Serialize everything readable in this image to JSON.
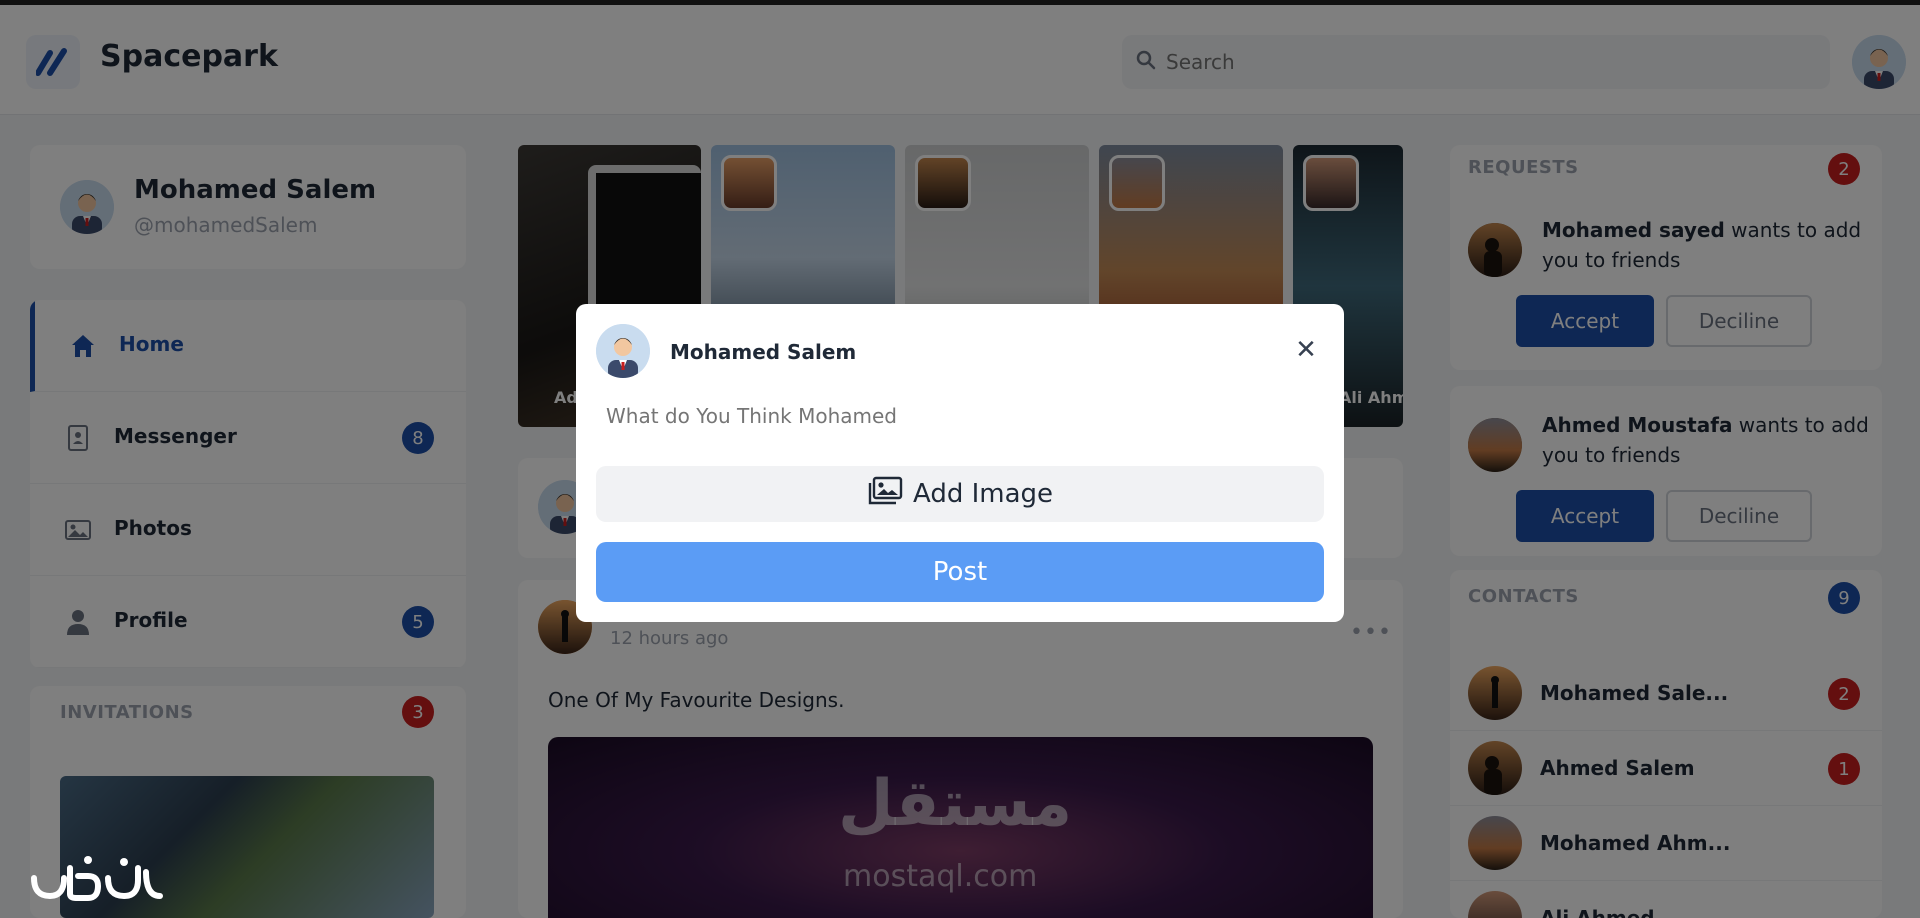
{
  "app": {
    "name": "Spacepark",
    "accent": "#1c4fa8"
  },
  "header": {
    "search_placeholder": "Search"
  },
  "profile": {
    "name": "Mohamed Salem",
    "handle": "@mohamedSalem"
  },
  "nav": {
    "items": [
      {
        "label": "Home",
        "icon": "home-icon",
        "active": true
      },
      {
        "label": "Messenger",
        "icon": "contact-book-icon",
        "badge": "8"
      },
      {
        "label": "Photos",
        "icon": "image-icon"
      },
      {
        "label": "Profile",
        "icon": "user-icon",
        "badge": "5"
      }
    ]
  },
  "invitations": {
    "title": "INVITATIONS",
    "count": "3"
  },
  "stories": [
    {
      "name": "Ad"
    },
    {
      "name": ""
    },
    {
      "name": ""
    },
    {
      "name": ""
    },
    {
      "name": "Ali Ahm"
    }
  ],
  "post": {
    "time": "12 hours ago",
    "text": "One Of My Favourite Designs.",
    "watermark_ar": "مستقل",
    "watermark_url": "mostaql.com"
  },
  "requests": {
    "title": "REQUESTS",
    "count": "2",
    "items": [
      {
        "name": "Mohamed sayed",
        "text": " wants to add you to friends",
        "accept": "Accept",
        "decline": "Deciline"
      },
      {
        "name": "Ahmed Moustafa",
        "text": " wants to add you to friends",
        "accept": "Accept",
        "decline": "Deciline"
      }
    ]
  },
  "contacts": {
    "title": "CONTACTS",
    "count": "9",
    "items": [
      {
        "name": "Mohamed Sale...",
        "badge": "2"
      },
      {
        "name": "Ahmed Salem",
        "badge": "1"
      },
      {
        "name": "Mohamed Ahm...",
        "badge": ""
      },
      {
        "name": "Ali Ahmed",
        "badge": ""
      }
    ]
  },
  "modal": {
    "user": "Mohamed Salem",
    "placeholder": "What do You Think Mohamed",
    "add_image": "Add Image",
    "post": "Post"
  }
}
